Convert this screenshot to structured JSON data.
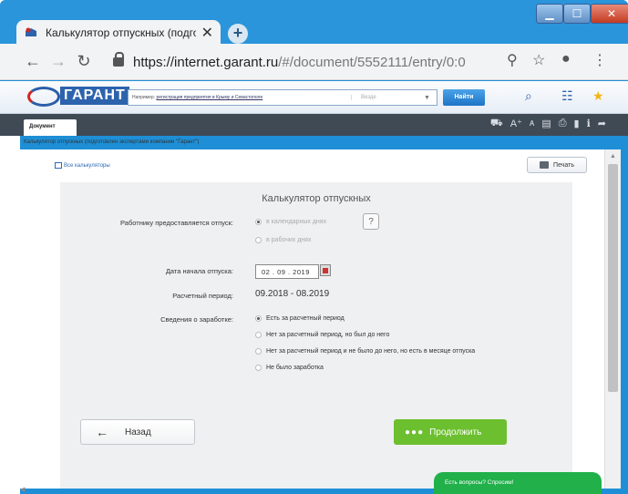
{
  "browser": {
    "tab_title": "Калькулятор отпускных (подгото",
    "tab_close": "✕",
    "new_tab": "+",
    "url_host": "https://internet.garant.ru",
    "url_path": "/#/document/5552111/entry/0:0",
    "controls": {
      "minimize": "▁",
      "maximize": "☐",
      "close": "✕"
    }
  },
  "garant": {
    "logo_text": "ГАРАНТ",
    "search_hint_prefix": "Например:",
    "search_hint_link": "регистрация предприятия в Крыму и Севастополе",
    "search_where": "Везде",
    "find_label": "Найти"
  },
  "doc": {
    "tab_label": "Документ",
    "breadcrumb": "Калькулятор отпускных (подготовлен экспертами компании \"Гарант\")",
    "all_calculators": "Все калькуляторы",
    "print_label": "Печать"
  },
  "form": {
    "title": "Калькулятор отпускных",
    "leave_label": "Работнику предоставляется отпуск:",
    "leave_options": [
      "в календарных днях",
      "в рабочих днях"
    ],
    "help": "?",
    "start_label": "Дата начала отпуска:",
    "start_value": "02 . 09 . 2019",
    "period_label": "Расчетный период:",
    "period_value": "09.2018 - 08.2019",
    "earnings_label": "Сведения о заработке:",
    "earnings_options": [
      "Есть за расчетный период",
      "Нет за расчетный период, но был до него",
      "Нет за расчетный период и не было до него, но есть в месяце отпуска",
      "Не было заработка"
    ],
    "back_label": "Назад",
    "next_label": "Продолжить"
  },
  "chat_label": "Есть вопросы? Спросим!"
}
